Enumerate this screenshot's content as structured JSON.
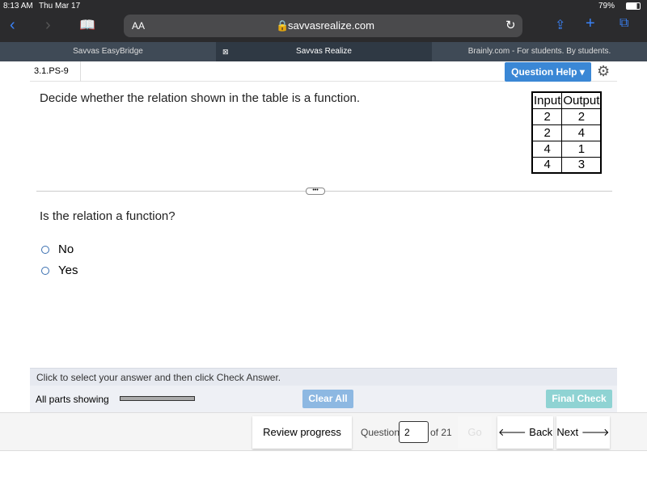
{
  "status": {
    "time": "8:13 AM",
    "date": "Thu Mar 17",
    "battery": "79%"
  },
  "browser": {
    "text_size": "AA",
    "url": "savvasrealize.com"
  },
  "tabs": [
    {
      "label": "Savvas EasyBridge"
    },
    {
      "label": "Savvas Realize",
      "active": true
    },
    {
      "label": "Brainly.com - For students. By students."
    }
  ],
  "question": {
    "id": "3.1.PS-9",
    "help_label": "Question Help ▾",
    "prompt": "Decide whether the relation shown in the table is a function.",
    "table": {
      "headers": [
        "Input",
        "Output"
      ],
      "rows": [
        [
          "2",
          "2"
        ],
        [
          "2",
          "4"
        ],
        [
          "4",
          "1"
        ],
        [
          "4",
          "3"
        ]
      ]
    },
    "sub_prompt": "Is the relation a function?",
    "options": [
      "No",
      "Yes"
    ]
  },
  "footer": {
    "instruction": "Click to select your answer and then click Check Answer.",
    "parts_label": "All parts showing",
    "clear_all": "Clear All",
    "final_check": "Final Check"
  },
  "nav": {
    "review": "Review progress",
    "question_label": "Question",
    "question_value": "2",
    "of": "of 21",
    "go": "Go",
    "back": "🡐 Back",
    "next": "Next 🡒"
  },
  "colors": {
    "accent": "#3a87d5",
    "final_check": "#8fd3d3"
  }
}
